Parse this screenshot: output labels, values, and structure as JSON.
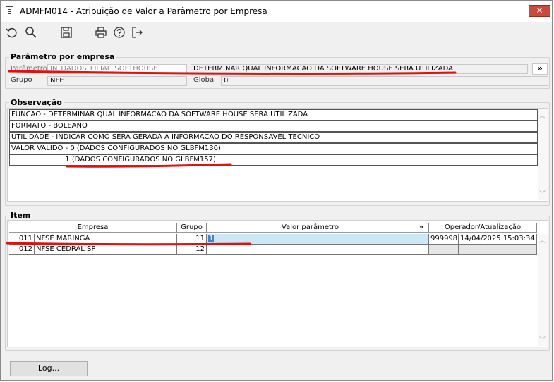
{
  "window": {
    "title": "ADMFM014 - Atribuição de Valor a Parâmetro por Empresa",
    "close_glyph": "✕"
  },
  "toolbar": {
    "icons": [
      "undo-icon",
      "search-icon",
      "save-icon",
      "print-icon",
      "help-icon",
      "exit-icon"
    ]
  },
  "parametro_por_empresa": {
    "group_label": "Parâmetro por empresa",
    "parametro_label": "Parâmetro",
    "parametro_value": "IN_DADOS_FILIAL_SOFTHOUSE",
    "descricao_value": "DETERMINAR QUAL INFORMACAO DA SOFTWARE HOUSE SERA UTILIZADA",
    "expand_label": "»",
    "grupo_label": "Grupo",
    "grupo_value": "NFE",
    "global_label": "Global",
    "global_value": "0"
  },
  "observacao": {
    "group_label": "Observação",
    "lines": [
      "FUNCAO - DETERMINAR QUAL INFORMACAO DA SOFTWARE HOUSE SERA UTILIZADA",
      "FORMATO - BOLEANO",
      "UTILIDADE - INDICAR COMO SERA GERADA A INFORMACAO DO RESPONSAVEL TECNICO",
      "VALOR VALIDO - 0 (DADOS CONFIGURADOS NO GLBFM130)",
      "                        1 (DADOS CONFIGURADOS NO GLBFM157)"
    ]
  },
  "item": {
    "group_label": "Item",
    "columns": {
      "empresa": "Empresa",
      "grupo": "Grupo",
      "valor": "Valor parâmetro",
      "expand": "»",
      "operador": "Operador/Atualização"
    },
    "rows": [
      {
        "code": "011",
        "empresa": "NFSE MARINGA",
        "grupo": "11",
        "valor": "1",
        "operador": "999998",
        "atualizacao": "14/04/2025 15:03:34"
      },
      {
        "code": "012",
        "empresa": "NFSE CEDRAL SP",
        "grupo": "12",
        "valor": "",
        "operador": "",
        "atualizacao": ""
      }
    ]
  },
  "footer": {
    "log_button": "Log..."
  },
  "colors": {
    "annotation_red": "#e01010",
    "selection": "#cbe8f6",
    "close_red": "#c94b3b"
  }
}
